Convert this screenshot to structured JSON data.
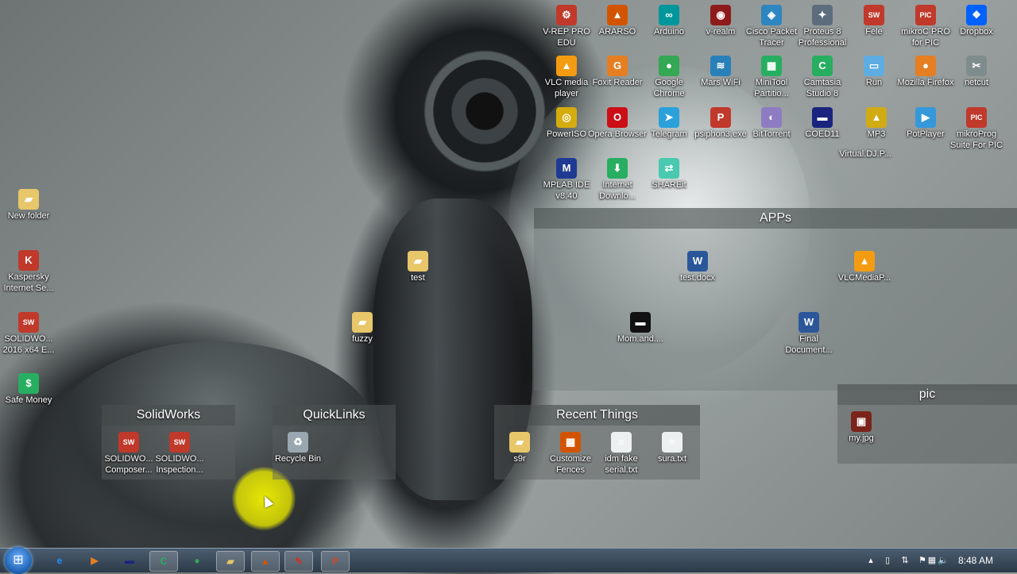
{
  "colors": {
    "taskbar": "#2c3a48",
    "highlight": "#e8e800"
  },
  "desktop_icons": [
    {
      "id": "vrep",
      "label": "V-REP PRO EDU",
      "icon": "vrep-icon",
      "glyph": "⚙",
      "color": "#c0392b"
    },
    {
      "id": "ararso",
      "label": "ARARSO",
      "icon": "matlab-icon",
      "glyph": "▲",
      "color": "#d35400"
    },
    {
      "id": "arduino",
      "label": "Arduino",
      "icon": "arduino-icon",
      "glyph": "∞",
      "color": "#00979c"
    },
    {
      "id": "vrealm",
      "label": "v-realm",
      "icon": "vrealm-icon",
      "glyph": "◉",
      "color": "#8e1b1b"
    },
    {
      "id": "cisco",
      "label": "Cisco Packet Tracer",
      "icon": "cisco-icon",
      "glyph": "◈",
      "color": "#2e86c1"
    },
    {
      "id": "proteus",
      "label": "Proteus 8 Professional",
      "icon": "proteus-icon",
      "glyph": "✦",
      "color": "#5d6d7e"
    },
    {
      "id": "fele",
      "label": "Fele",
      "icon": "solidworks-icon",
      "glyph": "SW",
      "color": "#c0392b"
    },
    {
      "id": "mikroc",
      "label": "mikroC PRO for PIC",
      "icon": "mikroc-icon",
      "glyph": "PIC",
      "color": "#c0392b"
    },
    {
      "id": "dropbox",
      "label": "Dropbox",
      "icon": "dropbox-icon",
      "glyph": "❖",
      "color": "#0061fe"
    },
    {
      "id": "vlc",
      "label": "VLC media player",
      "icon": "vlc-icon",
      "glyph": "▲",
      "color": "#f39c12"
    },
    {
      "id": "foxit",
      "label": "Foxit Reader",
      "icon": "foxit-icon",
      "glyph": "G",
      "color": "#e67e22"
    },
    {
      "id": "chrome",
      "label": "Google Chrome",
      "icon": "chrome-icon",
      "glyph": "●",
      "color": "#34a853"
    },
    {
      "id": "marswifi",
      "label": "Mars WiFi",
      "icon": "wifi-icon",
      "glyph": "≋",
      "color": "#2980b9"
    },
    {
      "id": "minitool",
      "label": "MiniTool Partitio...",
      "icon": "minitool-icon",
      "glyph": "▦",
      "color": "#27ae60"
    },
    {
      "id": "camtasia",
      "label": "Camtasia Studio 8",
      "icon": "camtasia-icon",
      "glyph": "C",
      "color": "#27ae60"
    },
    {
      "id": "run",
      "label": "Run",
      "icon": "run-icon",
      "glyph": "▭",
      "color": "#5dade2"
    },
    {
      "id": "firefox",
      "label": "Mozilla Firefox",
      "icon": "firefox-icon",
      "glyph": "●",
      "color": "#e67e22"
    },
    {
      "id": "netcut",
      "label": "netcut",
      "icon": "netcut-icon",
      "glyph": "✂",
      "color": "#7f8c8d"
    },
    {
      "id": "poweriso",
      "label": "PowerISO",
      "icon": "poweriso-icon",
      "glyph": "◎",
      "color": "#d4ac0d"
    },
    {
      "id": "opera",
      "label": "Opera Browser",
      "icon": "opera-icon",
      "glyph": "O",
      "color": "#cc0f16"
    },
    {
      "id": "telegram",
      "label": "Telegram",
      "icon": "telegram-icon",
      "glyph": "➤",
      "color": "#2aa1da"
    },
    {
      "id": "psiphon",
      "label": "psiphon3.exe",
      "icon": "psiphon-icon",
      "glyph": "P",
      "color": "#c0392b"
    },
    {
      "id": "bittorrent",
      "label": "BitTorrent",
      "icon": "bittorrent-icon",
      "glyph": "◐",
      "color": "#8e7cc3"
    },
    {
      "id": "coed",
      "label": "COED11",
      "icon": "coed-icon",
      "glyph": "▬",
      "color": "#1a237e"
    },
    {
      "id": "mp3",
      "label": "MP3",
      "icon": "mp3-icon",
      "glyph": "▲",
      "color": "#d4ac0d"
    },
    {
      "id": "virtualdj",
      "label": "Virtual.DJ.P...",
      "icon": "winrar-icon",
      "glyph": "▤",
      "color": "#8e44ad"
    },
    {
      "id": "potplayer",
      "label": "PotPlayer",
      "icon": "potplayer-icon",
      "glyph": "▶",
      "color": "#3498db"
    },
    {
      "id": "mikroprog",
      "label": "mikroProg Suite For PIC",
      "icon": "mikroprog-icon",
      "glyph": "PIC",
      "color": "#c0392b"
    },
    {
      "id": "mplab",
      "label": "MPLAB IDE v8.40",
      "icon": "mplab-icon",
      "glyph": "M",
      "color": "#1f3a93"
    },
    {
      "id": "idm",
      "label": "Internet Downlo...",
      "icon": "idm-icon",
      "glyph": "⬇",
      "color": "#27ae60"
    },
    {
      "id": "shareit",
      "label": "SHAREit",
      "icon": "shareit-icon",
      "glyph": "⇄",
      "color": "#48c9b0"
    },
    {
      "id": "newfolder",
      "label": "New folder",
      "icon": "folder-icon",
      "glyph": "▰",
      "color": "#e8c66a"
    },
    {
      "id": "kaspersky",
      "label": "Kaspersky Internet Se...",
      "icon": "kaspersky-icon",
      "glyph": "K",
      "color": "#c0392b"
    },
    {
      "id": "solidworks64",
      "label": "SOLIDWO... 2016 x64 E...",
      "icon": "solidworks-icon",
      "glyph": "SW",
      "color": "#c0392b"
    },
    {
      "id": "safemoney",
      "label": "Safe Money",
      "icon": "safemoney-icon",
      "glyph": "$",
      "color": "#27ae60"
    },
    {
      "id": "test",
      "label": "test",
      "icon": "folder-icon",
      "glyph": "▰",
      "color": "#e8c66a"
    },
    {
      "id": "testdocx",
      "label": "test.docx",
      "icon": "word-doc-icon",
      "glyph": "W",
      "color": "#2b579a"
    },
    {
      "id": "vlcmedia",
      "label": "VLCMediaP...",
      "icon": "vlc-icon",
      "glyph": "▲",
      "color": "#f39c12"
    },
    {
      "id": "fuzzy",
      "label": "fuzzy",
      "icon": "folder-icon",
      "glyph": "▰",
      "color": "#e8c66a"
    },
    {
      "id": "mom",
      "label": "Mom.and....",
      "icon": "video-file-icon",
      "glyph": "▬",
      "color": "#111111"
    },
    {
      "id": "finaldoc",
      "label": "Final Document...",
      "icon": "word-doc-icon",
      "glyph": "W",
      "color": "#2b579a"
    }
  ],
  "fences": {
    "apps": {
      "title": "APPs"
    },
    "solidworks": {
      "title": "SolidWorks",
      "items": [
        {
          "label": "SOLIDWO... Composer...",
          "icon": "solidworks-composer-icon",
          "glyph": "SW",
          "color": "#c0392b"
        },
        {
          "label": "SOLIDWO... Inspection...",
          "icon": "solidworks-inspection-icon",
          "glyph": "SW",
          "color": "#c0392b"
        }
      ]
    },
    "quicklinks": {
      "title": "QuickLinks",
      "items": [
        {
          "label": "Recycle Bin",
          "icon": "recycle-bin-icon",
          "glyph": "♻",
          "color": "#9aa7b0"
        }
      ]
    },
    "recent": {
      "title": "Recent Things",
      "items": [
        {
          "label": "s9r",
          "icon": "folder-icon",
          "glyph": "▰",
          "color": "#e8c66a"
        },
        {
          "label": "Customize Fences",
          "icon": "fences-icon",
          "glyph": "▦",
          "color": "#d35400"
        },
        {
          "label": "idm fake serial.txt",
          "icon": "text-file-icon",
          "glyph": "≡",
          "color": "#ecf0f1"
        },
        {
          "label": "sura.txt",
          "icon": "text-file-icon",
          "glyph": "≡",
          "color": "#ecf0f1"
        }
      ]
    },
    "pic": {
      "title": "pic",
      "items": [
        {
          "label": "my.jpg",
          "icon": "image-file-icon",
          "glyph": "▣",
          "color": "#7b241c"
        }
      ]
    }
  },
  "taskbar": {
    "start_glyph": "⊞",
    "buttons": [
      {
        "id": "ie",
        "icon": "ie-icon",
        "glyph": "e",
        "color": "#1e90ff"
      },
      {
        "id": "media",
        "icon": "media-player-icon",
        "glyph": "▶",
        "color": "#e67e22"
      },
      {
        "id": "coed",
        "icon": "coed-taskbar-icon",
        "glyph": "▬",
        "color": "#1a237e"
      },
      {
        "id": "camtasia",
        "icon": "camtasia-taskbar-icon",
        "glyph": "C",
        "color": "#27ae60"
      },
      {
        "id": "chrome",
        "icon": "chrome-taskbar-icon",
        "glyph": "●",
        "color": "#34a853"
      },
      {
        "id": "explorer",
        "icon": "explorer-icon",
        "glyph": "▰",
        "color": "#e8c66a"
      },
      {
        "id": "matlab",
        "icon": "matlab-taskbar-icon",
        "glyph": "▲",
        "color": "#d35400"
      },
      {
        "id": "tool",
        "icon": "tool-taskbar-icon",
        "glyph": "✎",
        "color": "#c0392b"
      },
      {
        "id": "powerpoint",
        "icon": "powerpoint-icon",
        "glyph": "P",
        "color": "#d24726"
      }
    ],
    "tray": [
      {
        "icon": "tray-up-arrow-icon",
        "glyph": "▴"
      },
      {
        "icon": "tray-device-icon",
        "glyph": "▯"
      },
      {
        "icon": "tray-network-sync-icon",
        "glyph": "⇅"
      },
      {
        "icon": "tray-flag-icon",
        "glyph": "⚑"
      },
      {
        "icon": "tray-network-icon",
        "glyph": "▦"
      },
      {
        "icon": "tray-volume-icon",
        "glyph": "🔈"
      }
    ],
    "clock": "8:48 AM"
  }
}
